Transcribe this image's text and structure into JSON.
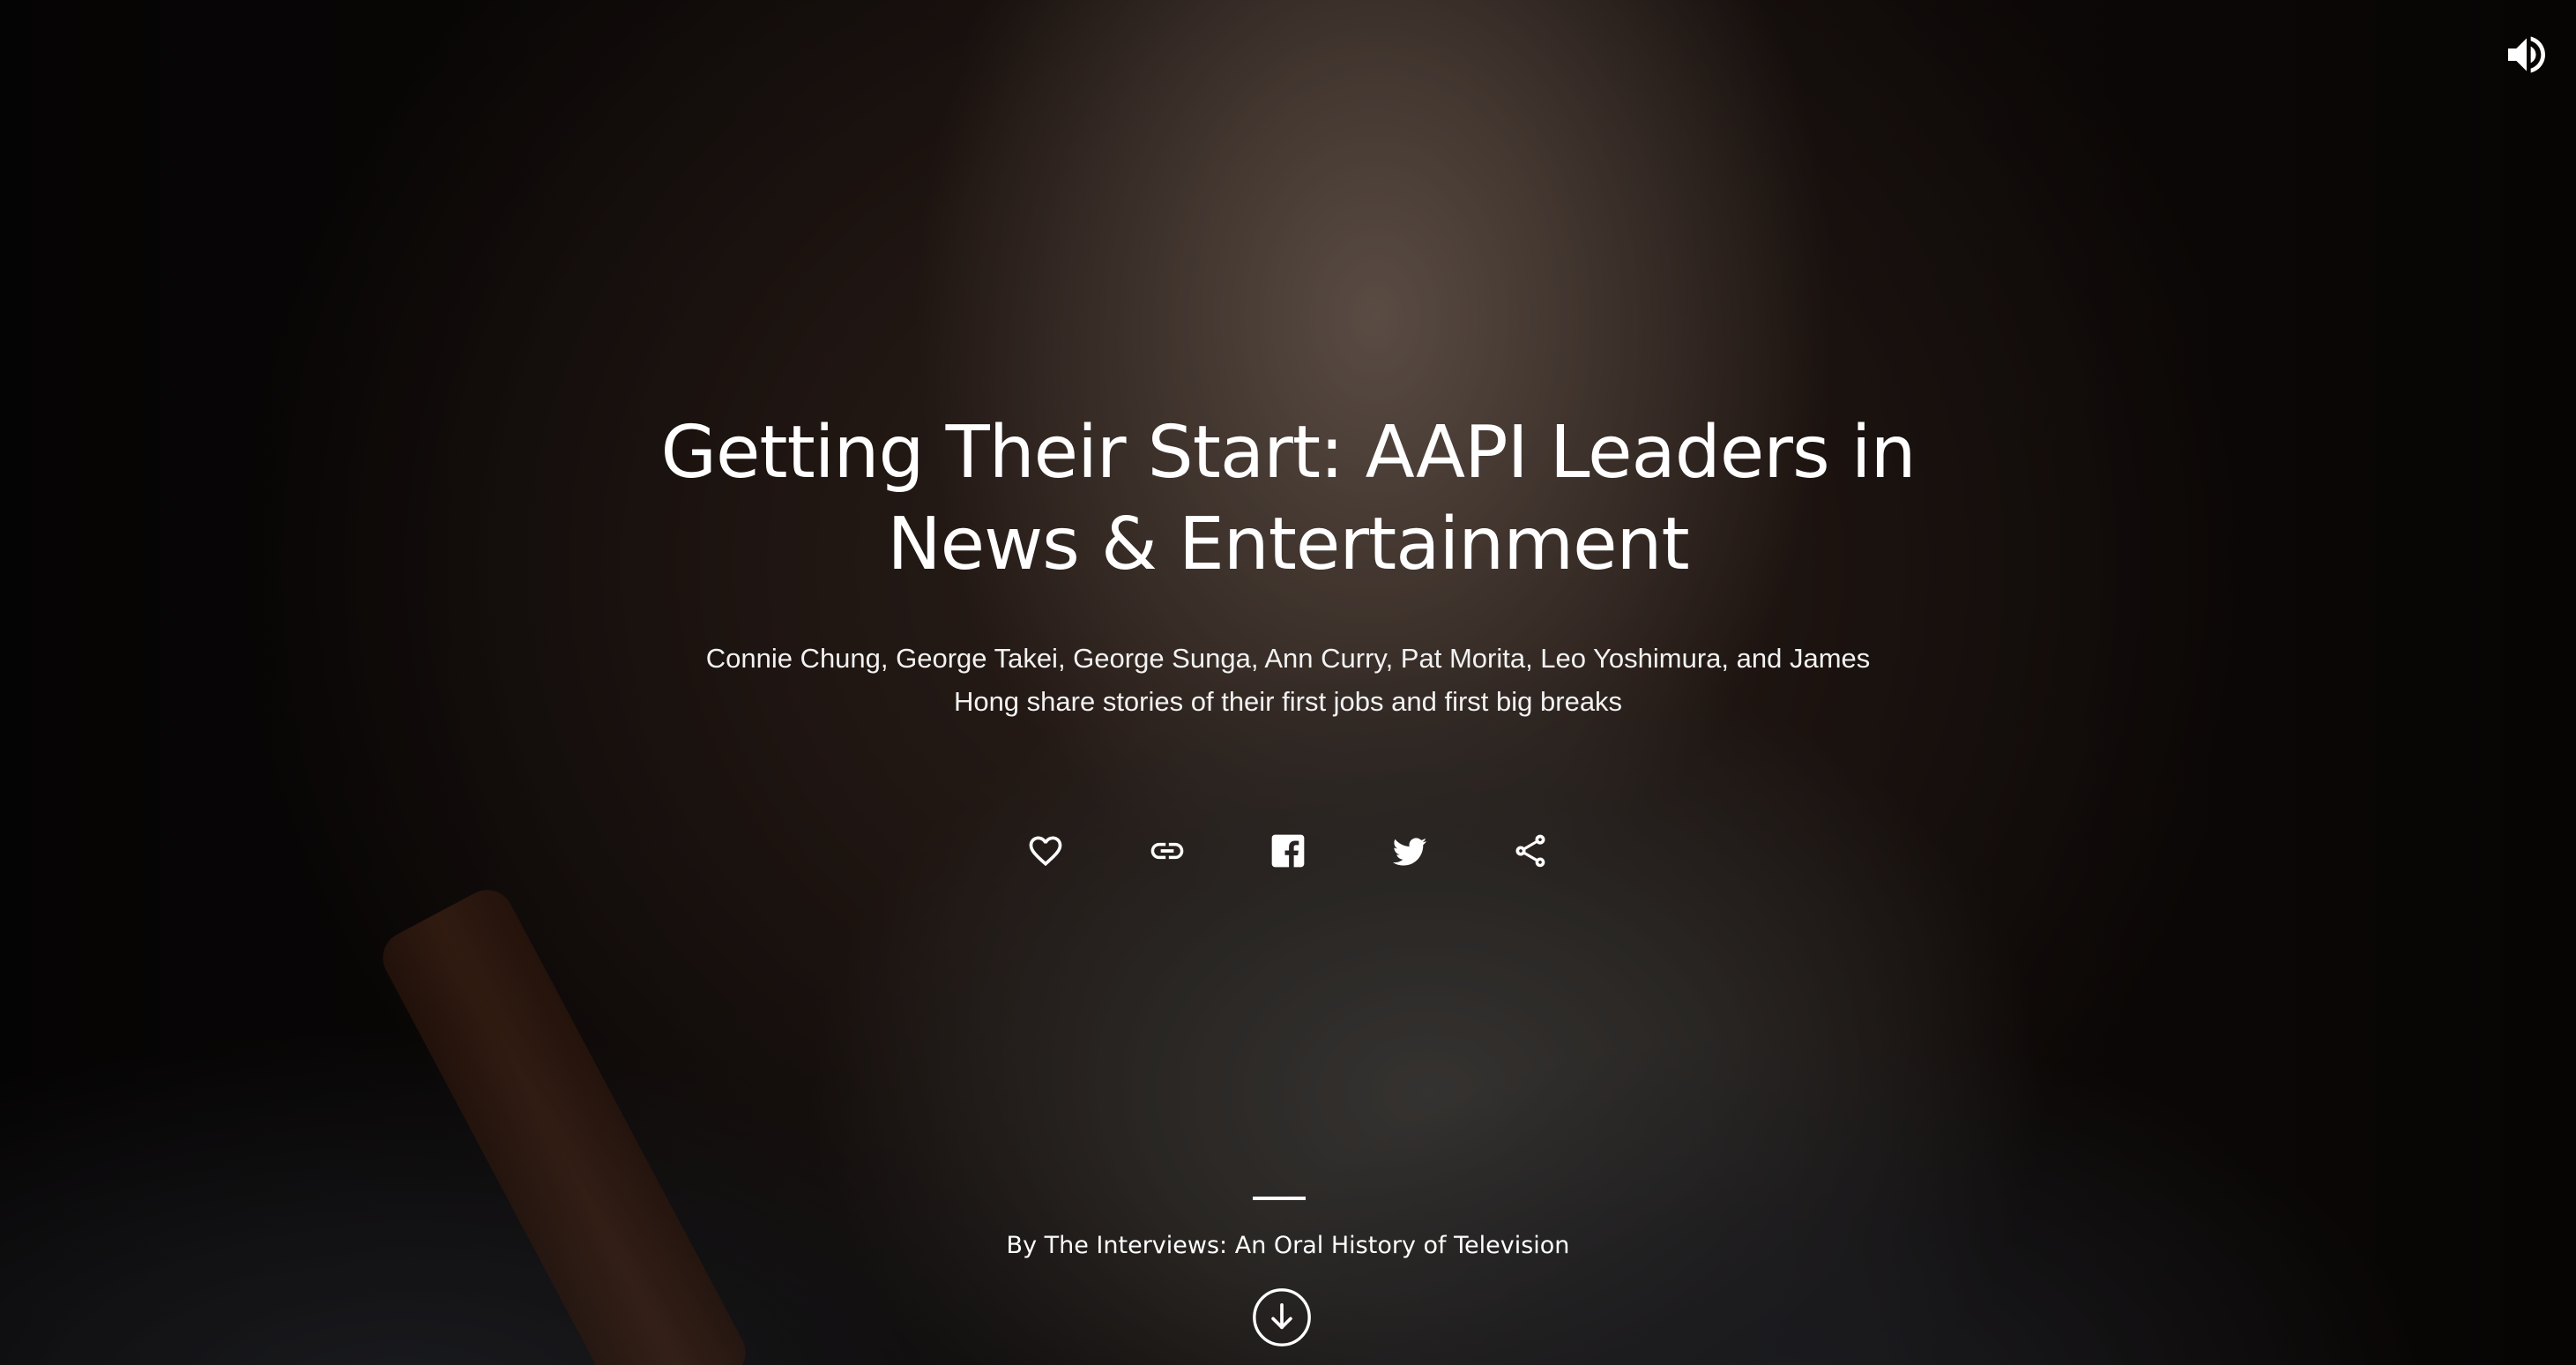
{
  "story": {
    "title_line1": "Getting Their Start: AAPI Leaders in",
    "title_line2": "News & Entertainment",
    "subtitle_line1": "Connie Chung, George Takei, George Sunga, Ann Curry, Pat Morita, Leo Yoshimura, and James",
    "subtitle_line2": "Hong share stories of their first jobs and first big breaks",
    "byline": "By The Interviews: An Oral History of Television"
  },
  "controls": {
    "sound_icon": "volume-up-icon",
    "actions": [
      {
        "icon": "heart-icon"
      },
      {
        "icon": "link-icon"
      },
      {
        "icon": "facebook-icon"
      },
      {
        "icon": "twitter-icon"
      },
      {
        "icon": "share-icon"
      }
    ],
    "scroll_icon": "arrow-down-circle-icon"
  },
  "colors": {
    "text": "#ffffff",
    "background": "#0b0807"
  }
}
